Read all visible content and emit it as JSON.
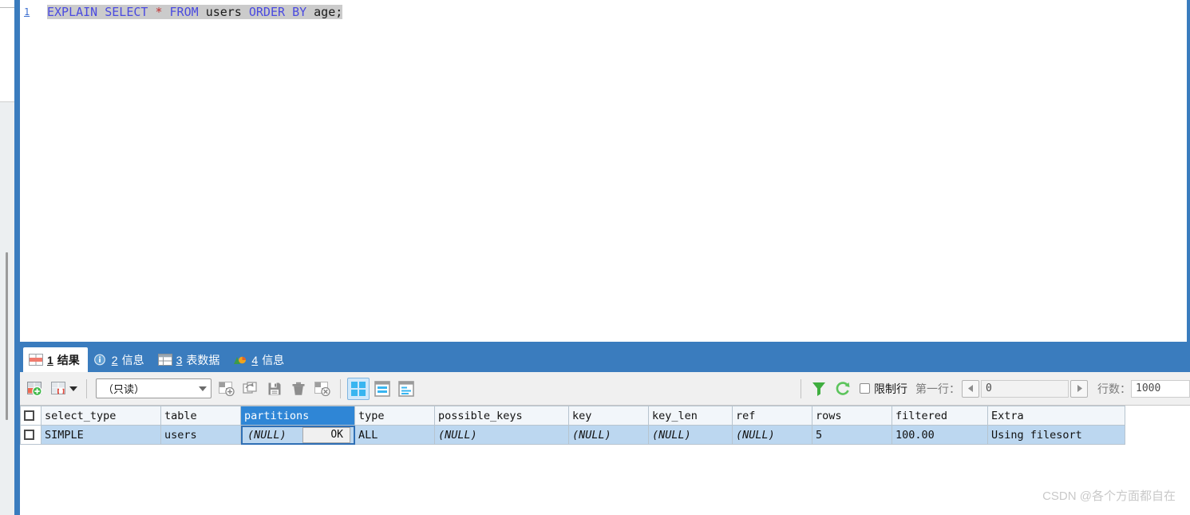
{
  "editor": {
    "line_number": "1",
    "query_tokens": [
      {
        "t": "EXPLAIN",
        "k": "kw"
      },
      {
        "t": " ",
        "k": "sp"
      },
      {
        "t": "SELECT",
        "k": "kw"
      },
      {
        "t": " ",
        "k": "sp"
      },
      {
        "t": "*",
        "k": "star"
      },
      {
        "t": " ",
        "k": "sp"
      },
      {
        "t": "FROM",
        "k": "kw"
      },
      {
        "t": " ",
        "k": "sp"
      },
      {
        "t": "users",
        "k": "ident"
      },
      {
        "t": " ",
        "k": "sp"
      },
      {
        "t": "ORDER",
        "k": "kw"
      },
      {
        "t": " ",
        "k": "sp"
      },
      {
        "t": "BY",
        "k": "kw"
      },
      {
        "t": " ",
        "k": "sp"
      },
      {
        "t": "age;",
        "k": "ident"
      }
    ],
    "query_text": "EXPLAIN SELECT * FROM users ORDER BY age;"
  },
  "tabs": [
    {
      "num": "1",
      "label": "结果",
      "icon": "results-grid-icon",
      "active": true
    },
    {
      "num": "2",
      "label": "信息",
      "icon": "info-circle-icon",
      "active": false
    },
    {
      "num": "3",
      "label": "表数据",
      "icon": "table-data-icon",
      "active": false
    },
    {
      "num": "4",
      "label": "信息",
      "icon": "profile-chart-icon",
      "active": false
    }
  ],
  "toolbar": {
    "add_record_label": "新建记录",
    "duplicate_dropdown_label": "复制记录",
    "mode_value": "（只读）",
    "insert_record_label": "添加记录",
    "copy_record_label": "复制记录",
    "save_record_label": "应用改变",
    "delete_record_label": "删除记录",
    "cancel_record_label": "放弃改变",
    "view_grid_label": "网格视图",
    "view_form_label": "表单视图",
    "view_text_label": "备注视图",
    "filter_label": "筛选向导",
    "refresh_label": "刷新",
    "limit_rows_label": "限制行",
    "limit_rows_checked": false,
    "first_row_label": "第一行：",
    "first_row_value": "0",
    "row_count_label": "行数：",
    "row_count_value": "1000"
  },
  "grid": {
    "columns": [
      "select_type",
      "table",
      "partitions",
      "type",
      "possible_keys",
      "key",
      "key_len",
      "ref",
      "rows",
      "filtered",
      "Extra"
    ],
    "selected_column": "partitions",
    "rows": [
      {
        "select_type": "SIMPLE",
        "table": "users",
        "partitions": "(NULL)",
        "partitions_button": "OK",
        "type": "ALL",
        "possible_keys": "(NULL)",
        "key": "(NULL)",
        "key_len": "(NULL)",
        "ref": "(NULL)",
        "rows": "5",
        "filtered": "100.00",
        "Extra": "Using filesort"
      }
    ]
  },
  "watermark": "CSDN @各个方面都自在",
  "colors": {
    "tabbar_blue": "#3a7cbe",
    "header_selected_blue": "#2f86d6",
    "row_selected_blue": "#bcd7f0",
    "keyword_blue": "#4a4ae0",
    "accent_green": "#4caf50"
  }
}
